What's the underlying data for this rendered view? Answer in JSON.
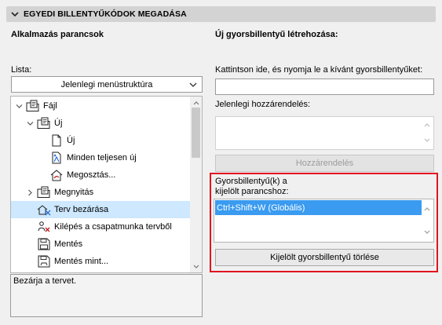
{
  "header": {
    "title": "EGYEDI BILLENTYŰKÓDOK MEGADÁSA",
    "icon": "chevron-down-icon"
  },
  "left": {
    "heading": "Alkalmazás parancsok",
    "list_label": "Lista:",
    "list_select_value": "Jelenlegi menüstruktúra",
    "tree": [
      {
        "label": "Fájl",
        "icon": "folder-doc-icon",
        "expander": "open"
      },
      {
        "label": "Új",
        "icon": "folder-doc-icon",
        "expander": "open"
      },
      {
        "label": "Új",
        "icon": "blank-page-icon",
        "expander": "none"
      },
      {
        "label": "Minden teljesen új",
        "icon": "sparkle-page-icon",
        "expander": "none"
      },
      {
        "label": "Megosztás...",
        "icon": "share-house-icon",
        "expander": "none"
      },
      {
        "label": "Megnyitás",
        "icon": "folder-doc-icon",
        "expander": "closed"
      },
      {
        "label": "Terv bezárása",
        "icon": "close-plan-icon",
        "expander": "none",
        "selected": true
      },
      {
        "label": "Kilépés a csapatmunka tervből",
        "icon": "exit-team-icon",
        "expander": "none"
      },
      {
        "label": "Mentés",
        "icon": "save-icon",
        "expander": "none"
      },
      {
        "label": "Mentés mint...",
        "icon": "save-as-icon",
        "expander": "none"
      }
    ],
    "description": "Bezárja a tervet."
  },
  "right": {
    "heading": "Új gyorsbillentyű létrehozása:",
    "instruction": "Kattintson ide, és nyomja le a kívánt gyorsbillentyűket:",
    "input_value": "",
    "current_assignment_label": "Jelenlegi hozzárendelés:",
    "assign_button": "Hozzárendelés",
    "shortcuts_label_line1": "Gyorsbillentyű(k) a",
    "shortcuts_label_line2": "kijelölt parancshoz:",
    "shortcuts": [
      "Ctrl+Shift+W (Globális)"
    ],
    "delete_button": "Kijelölt gyorsbillentyű törlése"
  },
  "colors": {
    "selection": "#cde8ff",
    "list_highlight": "#3a9bf0",
    "frame": "#e0151f"
  }
}
